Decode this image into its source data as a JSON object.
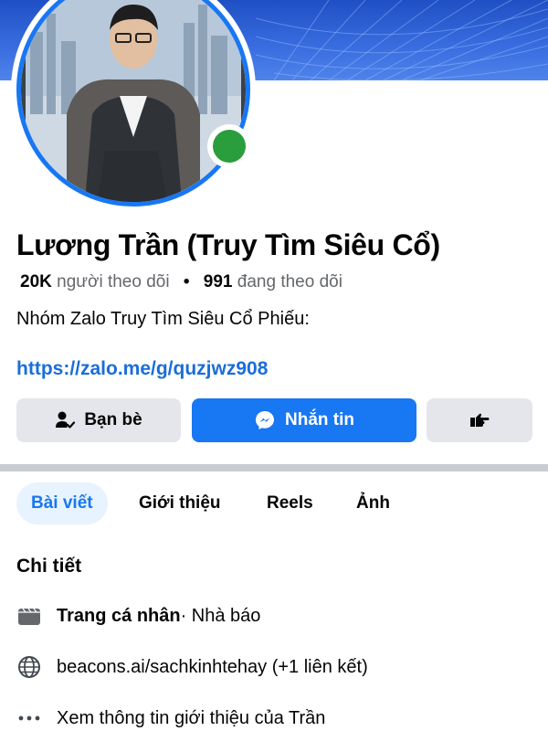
{
  "profile": {
    "name": "Lương Trần (Truy Tìm Siêu Cổ)",
    "followers_count": "20K",
    "followers_label": "người theo dõi",
    "following_count": "991",
    "following_label": "đang theo dõi",
    "bio": "Nhóm Zalo Truy Tìm Siêu Cổ Phiếu:",
    "link": "https://zalo.me/g/quzjwz908",
    "online": true
  },
  "actions": {
    "friends_label": "Bạn bè",
    "message_label": "Nhắn tin",
    "more_icon": "pointing-hand-icon"
  },
  "tabs": [
    {
      "label": "Bài viết",
      "active": true
    },
    {
      "label": "Giới thiệu",
      "active": false
    },
    {
      "label": "Reels",
      "active": false
    },
    {
      "label": "Ảnh",
      "active": false
    }
  ],
  "details": {
    "title": "Chi tiết",
    "page_type_bold": "Trang cá nhân",
    "page_type_rest": " · Nhà báo",
    "website": "beacons.ai/sachkinhtehay (+1 liên kết)",
    "see_more": "Xem thông tin giới thiệu của Trần"
  },
  "colors": {
    "accent": "#1877f2",
    "online": "#2a9d3c",
    "button_gray": "#e4e6eb"
  }
}
